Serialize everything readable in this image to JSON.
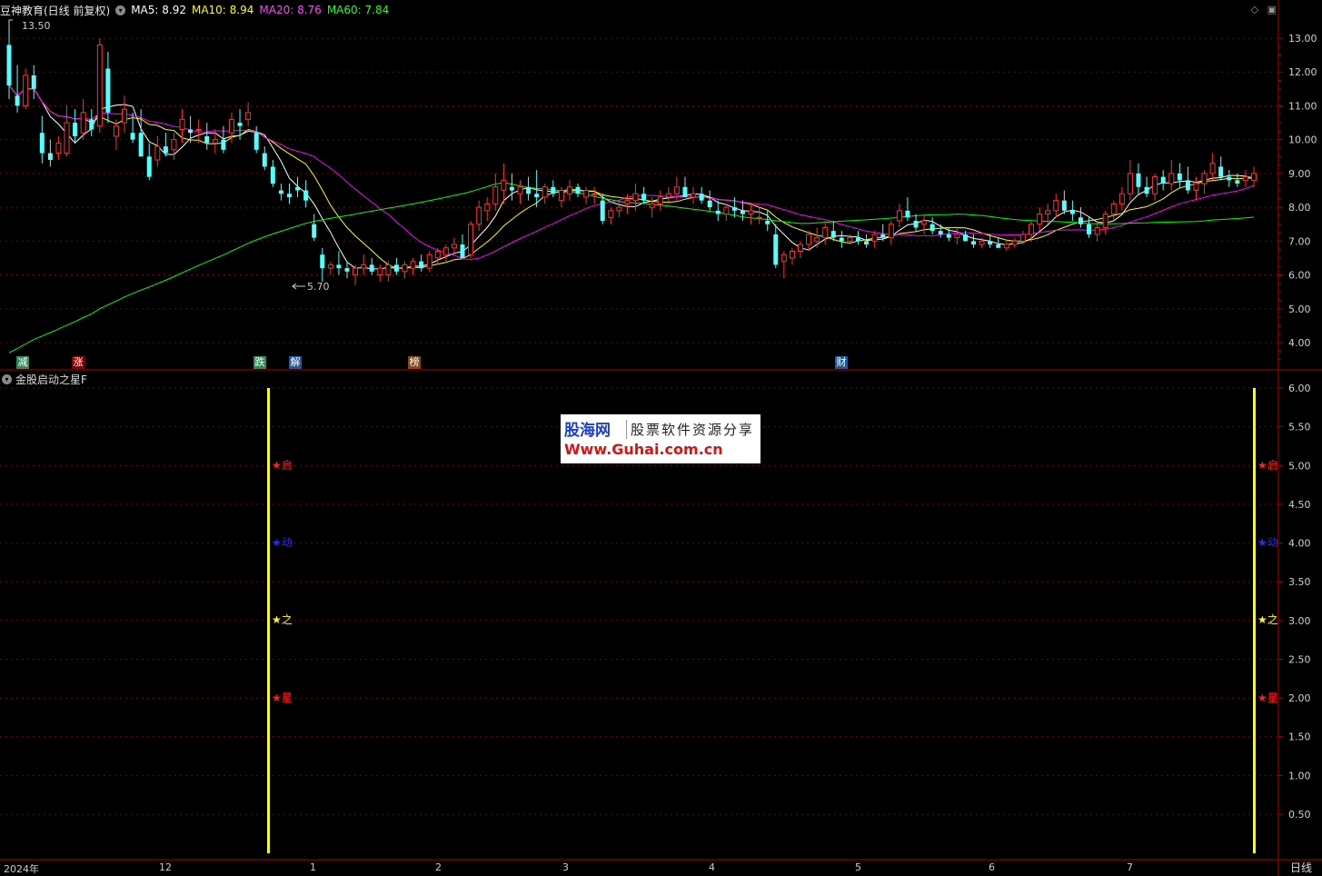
{
  "header": {
    "title": "豆神教育(日线 前复权)",
    "ma5": "MA5: 8.92",
    "ma10": "MA10: 8.94",
    "ma20": "MA20: 8.76",
    "ma60": "MA60: 7.84",
    "colors": {
      "ma5": "#ffffff",
      "ma10": "#ffff00",
      "ma20": "#ff00ff",
      "ma60": "#00ff00",
      "up": "#ff3232",
      "down": "#54ffff",
      "grid": "#8b0000"
    }
  },
  "price_axis": [
    "13.00",
    "12.00",
    "11.00",
    "10.00",
    "9.00",
    "8.00",
    "7.00",
    "6.00",
    "5.00",
    "4.00"
  ],
  "high_marker": "13.50",
  "low_marker": "5.70",
  "events": [
    {
      "label": "减",
      "color": "#2e8b57"
    },
    {
      "label": "涨",
      "color": "#8b0000"
    },
    {
      "label": "跌",
      "color": "#2e8b57"
    },
    {
      "label": "解",
      "color": "#1e5a9a"
    },
    {
      "label": "榜",
      "color": "#8b4513"
    },
    {
      "label": "财",
      "color": "#1e5a9a"
    }
  ],
  "indicator": {
    "title": "金股启动之星F",
    "axis": [
      "6.00",
      "5.50",
      "5.00",
      "4.50",
      "4.00",
      "3.50",
      "3.00",
      "2.50",
      "2.00",
      "1.50",
      "1.00",
      "0.50"
    ],
    "stars": [
      {
        "label": "★启",
        "color": "#ff2020"
      },
      {
        "label": "★动",
        "color": "#2020ff"
      },
      {
        "label": "★之",
        "color": "#ffff00"
      },
      {
        "label": "★星",
        "color": "#ff2020"
      }
    ]
  },
  "watermark": {
    "brand": "股海网",
    "slogan": "股票软件资源分享",
    "url": "Www.Guhai.com.cn"
  },
  "time_axis": [
    "2024年",
    "12",
    "1",
    "2",
    "3",
    "4",
    "5",
    "6",
    "7"
  ],
  "period": "日线",
  "chart_data": {
    "type": "candlestick",
    "title": "豆神教育(日线 前复权)",
    "ylim": [
      3.6,
      13.5
    ],
    "ohlc": [
      [
        12.8,
        13.5,
        11.2,
        11.6
      ],
      [
        11.3,
        12.2,
        10.8,
        11.0
      ],
      [
        11.0,
        12.1,
        10.9,
        11.9
      ],
      [
        11.9,
        12.2,
        11.2,
        11.5
      ],
      [
        10.2,
        10.7,
        9.3,
        9.6
      ],
      [
        9.6,
        10.0,
        9.2,
        9.4
      ],
      [
        9.6,
        10.1,
        9.4,
        9.9
      ],
      [
        9.6,
        11.0,
        9.5,
        10.5
      ],
      [
        10.5,
        10.9,
        9.9,
        10.1
      ],
      [
        10.2,
        11.2,
        10.0,
        10.8
      ],
      [
        10.6,
        10.9,
        10.1,
        10.3
      ],
      [
        10.4,
        13.0,
        10.2,
        12.8
      ],
      [
        12.1,
        12.6,
        10.5,
        10.8
      ],
      [
        10.1,
        10.6,
        9.7,
        10.4
      ],
      [
        10.5,
        11.3,
        10.2,
        10.9
      ],
      [
        10.2,
        10.8,
        9.9,
        10.0
      ],
      [
        10.2,
        10.9,
        9.8,
        9.5
      ],
      [
        9.5,
        9.9,
        8.8,
        8.9
      ],
      [
        9.4,
        10.1,
        9.2,
        9.8
      ],
      [
        9.8,
        10.2,
        9.5,
        9.6
      ],
      [
        9.7,
        10.2,
        9.4,
        10.0
      ],
      [
        10.3,
        10.9,
        9.9,
        10.6
      ],
      [
        10.3,
        10.7,
        9.9,
        10.2
      ],
      [
        10.3,
        10.6,
        9.9,
        10.3
      ],
      [
        10.1,
        10.5,
        9.7,
        9.9
      ],
      [
        9.9,
        10.3,
        9.6,
        10.0
      ],
      [
        10.0,
        10.4,
        9.6,
        9.7
      ],
      [
        10.2,
        10.8,
        9.9,
        10.6
      ],
      [
        10.5,
        10.9,
        10.0,
        10.4
      ],
      [
        10.6,
        11.1,
        10.4,
        10.8
      ],
      [
        10.2,
        10.4,
        9.6,
        9.7
      ],
      [
        9.6,
        9.8,
        9.1,
        9.2
      ],
      [
        9.2,
        9.4,
        8.6,
        8.7
      ],
      [
        8.5,
        8.7,
        8.2,
        8.4
      ],
      [
        8.4,
        8.7,
        8.1,
        8.3
      ],
      [
        8.6,
        8.9,
        8.3,
        8.5
      ],
      [
        8.5,
        8.8,
        8.0,
        8.2
      ],
      [
        7.5,
        7.8,
        7.0,
        7.1
      ],
      [
        6.6,
        6.8,
        5.8,
        6.2
      ],
      [
        6.2,
        6.4,
        6.0,
        6.3
      ],
      [
        6.3,
        6.7,
        6.0,
        6.2
      ],
      [
        6.2,
        6.4,
        5.9,
        6.1
      ],
      [
        6.0,
        6.3,
        5.7,
        6.2
      ],
      [
        6.2,
        6.6,
        6.0,
        6.3
      ],
      [
        6.3,
        6.5,
        6.0,
        6.1
      ],
      [
        6.0,
        6.3,
        5.8,
        6.2
      ],
      [
        6.0,
        6.4,
        5.8,
        6.3
      ],
      [
        6.3,
        6.5,
        6.0,
        6.1
      ],
      [
        6.1,
        6.4,
        5.9,
        6.3
      ],
      [
        6.2,
        6.5,
        6.0,
        6.4
      ],
      [
        6.4,
        6.6,
        6.1,
        6.2
      ],
      [
        6.2,
        6.7,
        6.1,
        6.6
      ],
      [
        6.5,
        6.8,
        6.3,
        6.7
      ],
      [
        6.6,
        6.9,
        6.4,
        6.8
      ],
      [
        6.8,
        7.1,
        6.6,
        6.9
      ],
      [
        6.9,
        7.2,
        6.5,
        6.5
      ],
      [
        6.6,
        7.6,
        6.5,
        7.5
      ],
      [
        7.5,
        8.2,
        7.3,
        8.0
      ],
      [
        7.9,
        8.3,
        7.6,
        8.1
      ],
      [
        8.1,
        9.0,
        7.9,
        8.6
      ],
      [
        8.5,
        9.3,
        8.1,
        8.8
      ],
      [
        8.6,
        9.0,
        8.2,
        8.5
      ],
      [
        8.4,
        8.8,
        8.1,
        8.6
      ],
      [
        8.6,
        8.9,
        8.2,
        8.4
      ],
      [
        8.4,
        9.1,
        8.0,
        8.3
      ],
      [
        8.3,
        8.7,
        8.1,
        8.6
      ],
      [
        8.6,
        8.8,
        8.3,
        8.4
      ],
      [
        8.2,
        8.6,
        8.0,
        8.5
      ],
      [
        8.4,
        8.8,
        8.2,
        8.6
      ],
      [
        8.6,
        8.7,
        8.3,
        8.4
      ],
      [
        8.3,
        8.6,
        8.1,
        8.5
      ],
      [
        8.4,
        8.6,
        8.1,
        8.4
      ],
      [
        8.2,
        8.4,
        7.5,
        7.6
      ],
      [
        7.7,
        8.0,
        7.5,
        7.9
      ],
      [
        7.9,
        8.2,
        7.7,
        8.0
      ],
      [
        8.1,
        8.4,
        7.8,
        8.2
      ],
      [
        8.2,
        8.7,
        7.9,
        8.4
      ],
      [
        8.4,
        8.6,
        8.1,
        8.2
      ],
      [
        8.0,
        8.3,
        7.7,
        8.1
      ],
      [
        8.1,
        8.5,
        7.9,
        8.3
      ],
      [
        8.3,
        8.6,
        8.1,
        8.4
      ],
      [
        8.4,
        8.9,
        8.2,
        8.6
      ],
      [
        8.6,
        8.9,
        8.3,
        8.3
      ],
      [
        8.3,
        8.6,
        8.1,
        8.4
      ],
      [
        8.4,
        8.6,
        8.1,
        8.2
      ],
      [
        8.2,
        8.5,
        7.9,
        8.0
      ],
      [
        7.9,
        8.2,
        7.6,
        7.8
      ],
      [
        7.8,
        8.1,
        7.6,
        8.0
      ],
      [
        8.0,
        8.3,
        7.7,
        7.9
      ],
      [
        7.9,
        8.2,
        7.6,
        7.8
      ],
      [
        7.8,
        8.1,
        7.5,
        7.9
      ],
      [
        7.7,
        8.0,
        7.5,
        7.7
      ],
      [
        7.6,
        7.9,
        7.3,
        7.5
      ],
      [
        7.2,
        7.5,
        6.2,
        6.3
      ],
      [
        6.4,
        6.7,
        5.9,
        6.6
      ],
      [
        6.5,
        6.8,
        6.3,
        6.7
      ],
      [
        6.7,
        7.0,
        6.5,
        6.9
      ],
      [
        6.9,
        7.3,
        6.7,
        7.2
      ],
      [
        7.0,
        7.4,
        6.8,
        7.1
      ],
      [
        7.1,
        7.6,
        6.9,
        7.4
      ],
      [
        7.3,
        7.6,
        7.0,
        7.1
      ],
      [
        7.1,
        7.3,
        6.8,
        7.0
      ],
      [
        7.0,
        7.2,
        6.9,
        7.1
      ],
      [
        7.1,
        7.3,
        6.9,
        7.0
      ],
      [
        7.0,
        7.2,
        6.8,
        6.9
      ],
      [
        7.0,
        7.3,
        6.8,
        7.2
      ],
      [
        7.2,
        7.5,
        7.0,
        7.1
      ],
      [
        7.1,
        7.6,
        6.9,
        7.5
      ],
      [
        7.6,
        8.1,
        7.4,
        7.9
      ],
      [
        7.9,
        8.3,
        7.6,
        7.7
      ],
      [
        7.6,
        7.8,
        7.3,
        7.4
      ],
      [
        7.5,
        7.8,
        7.2,
        7.6
      ],
      [
        7.5,
        7.7,
        7.2,
        7.3
      ],
      [
        7.3,
        7.5,
        7.1,
        7.2
      ],
      [
        7.2,
        7.4,
        7.0,
        7.1
      ],
      [
        7.1,
        7.4,
        6.9,
        7.2
      ],
      [
        7.2,
        7.3,
        7.0,
        7.0
      ],
      [
        7.0,
        7.2,
        6.8,
        6.9
      ],
      [
        6.9,
        7.1,
        6.8,
        7.0
      ],
      [
        7.0,
        7.2,
        6.8,
        6.9
      ],
      [
        6.9,
        7.1,
        6.8,
        6.8
      ],
      [
        6.8,
        7.0,
        6.7,
        6.9
      ],
      [
        6.9,
        7.1,
        6.8,
        7.0
      ],
      [
        7.0,
        7.3,
        6.9,
        7.2
      ],
      [
        7.2,
        7.6,
        7.0,
        7.5
      ],
      [
        7.5,
        8.0,
        7.3,
        7.8
      ],
      [
        7.8,
        8.1,
        7.5,
        7.9
      ],
      [
        7.9,
        8.4,
        7.7,
        8.2
      ],
      [
        8.2,
        8.5,
        7.8,
        7.9
      ],
      [
        7.9,
        8.2,
        7.6,
        7.8
      ],
      [
        7.7,
        8.0,
        7.4,
        7.5
      ],
      [
        7.5,
        7.7,
        7.1,
        7.2
      ],
      [
        7.2,
        7.6,
        7.0,
        7.4
      ],
      [
        7.4,
        7.9,
        7.2,
        7.8
      ],
      [
        7.8,
        8.2,
        7.6,
        8.1
      ],
      [
        8.1,
        8.6,
        7.9,
        8.4
      ],
      [
        8.4,
        9.4,
        8.2,
        9.0
      ],
      [
        9.0,
        9.3,
        8.4,
        8.6
      ],
      [
        8.6,
        8.9,
        8.3,
        8.4
      ],
      [
        8.4,
        9.0,
        8.2,
        8.9
      ],
      [
        8.9,
        9.1,
        8.5,
        8.7
      ],
      [
        8.7,
        9.4,
        8.5,
        9.0
      ],
      [
        9.0,
        9.3,
        8.6,
        8.8
      ],
      [
        8.8,
        9.2,
        8.4,
        8.5
      ],
      [
        8.5,
        8.9,
        8.2,
        8.7
      ],
      [
        8.7,
        9.1,
        8.4,
        9.0
      ],
      [
        9.0,
        9.6,
        8.8,
        9.3
      ],
      [
        9.2,
        9.5,
        8.8,
        8.9
      ],
      [
        8.9,
        9.1,
        8.6,
        8.8
      ],
      [
        8.8,
        9.0,
        8.6,
        8.7
      ],
      [
        8.8,
        9.1,
        8.6,
        8.9
      ],
      [
        8.8,
        9.2,
        8.6,
        9.0
      ]
    ],
    "moving_averages": [
      {
        "name": "MA5",
        "value": 8.92
      },
      {
        "name": "MA10",
        "value": 8.94
      },
      {
        "name": "MA20",
        "value": 8.76
      },
      {
        "name": "MA60",
        "value": 7.84
      }
    ],
    "high": 13.5,
    "low": 5.7
  }
}
